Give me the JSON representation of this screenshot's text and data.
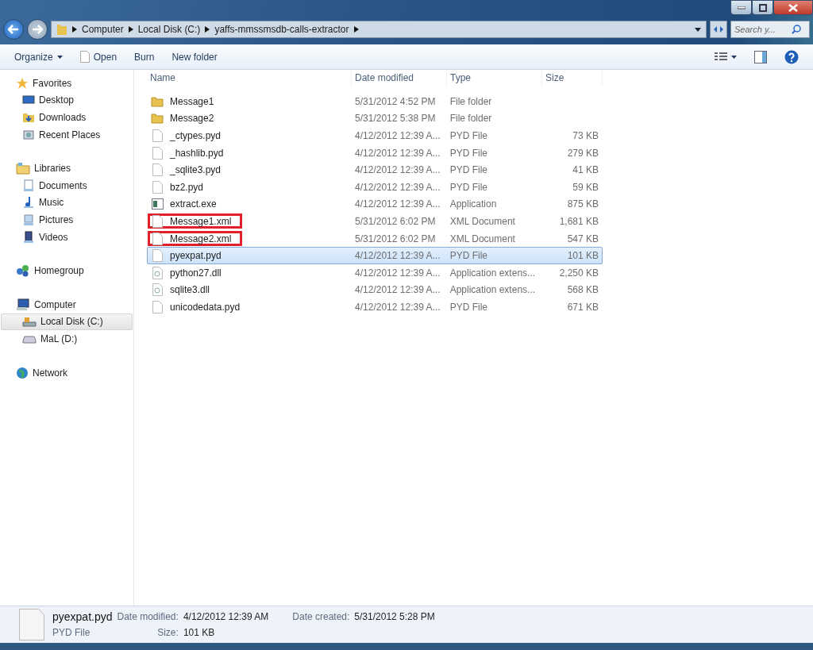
{
  "address": {
    "path": [
      "Computer",
      "Local Disk (C:)",
      "yaffs-mmssmsdb-calls-extractor"
    ],
    "search_placeholder": "Search y..."
  },
  "toolbar": [
    {
      "label": "Organize",
      "kind": "menu"
    },
    {
      "label": "Open",
      "kind": "icon"
    },
    {
      "label": "Burn",
      "kind": "plain"
    },
    {
      "label": "New folder",
      "kind": "plain"
    }
  ],
  "sidebar": [
    {
      "label": "Favorites",
      "kind": "star",
      "selected": false,
      "children": [
        {
          "label": "Desktop",
          "kind": "desktop",
          "selected": false
        },
        {
          "label": "Downloads",
          "kind": "download",
          "selected": false
        },
        {
          "label": "Recent Places",
          "kind": "recent",
          "selected": false
        }
      ]
    },
    {
      "label": "Libraries",
      "kind": "library",
      "selected": false,
      "children": [
        {
          "label": "Documents",
          "kind": "doc",
          "selected": false
        },
        {
          "label": "Music",
          "kind": "music",
          "selected": false
        },
        {
          "label": "Pictures",
          "kind": "picture",
          "selected": false
        },
        {
          "label": "Videos",
          "kind": "video",
          "selected": false
        }
      ]
    },
    {
      "label": "Homegroup",
      "kind": "homegroup",
      "selected": false
    },
    {
      "label": "Computer",
      "kind": "computer",
      "selected": false,
      "children": [
        {
          "label": "Local Disk (C:)",
          "kind": "disk",
          "selected": true
        },
        {
          "label": "MaL (D:)",
          "kind": "drive",
          "selected": false
        }
      ]
    },
    {
      "label": "Network",
      "kind": "network",
      "selected": false
    }
  ],
  "table": {
    "columns": [
      "Name",
      "Date modified",
      "Type",
      "Size"
    ],
    "rows": [
      {
        "kind": "folder",
        "name": "Message1",
        "date": "5/31/2012 4:52 PM",
        "type": "File folder",
        "size": "",
        "selected": false,
        "boxed": false
      },
      {
        "kind": "folder",
        "name": "Message2",
        "date": "5/31/2012 5:38 PM",
        "type": "File folder",
        "size": "",
        "selected": false,
        "boxed": false
      },
      {
        "kind": "file",
        "name": "_ctypes.pyd",
        "date": "4/12/2012 12:39 A...",
        "type": "PYD File",
        "size": "73 KB",
        "selected": false,
        "boxed": false
      },
      {
        "kind": "file",
        "name": "_hashlib.pyd",
        "date": "4/12/2012 12:39 A...",
        "type": "PYD File",
        "size": "279 KB",
        "selected": false,
        "boxed": false
      },
      {
        "kind": "file",
        "name": "_sqlite3.pyd",
        "date": "4/12/2012 12:39 A...",
        "type": "PYD File",
        "size": "41 KB",
        "selected": false,
        "boxed": false
      },
      {
        "kind": "file",
        "name": "bz2.pyd",
        "date": "4/12/2012 12:39 A...",
        "type": "PYD File",
        "size": "59 KB",
        "selected": false,
        "boxed": false
      },
      {
        "kind": "exe",
        "name": "extract.exe",
        "date": "4/12/2012 12:39 A...",
        "type": "Application",
        "size": "875 KB",
        "selected": false,
        "boxed": false
      },
      {
        "kind": "file",
        "name": "Message1.xml",
        "date": "5/31/2012 6:02 PM",
        "type": "XML Document",
        "size": "1,681 KB",
        "selected": false,
        "boxed": true
      },
      {
        "kind": "file",
        "name": "Message2.xml",
        "date": "5/31/2012 6:02 PM",
        "type": "XML Document",
        "size": "547 KB",
        "selected": false,
        "boxed": true
      },
      {
        "kind": "file",
        "name": "pyexpat.pyd",
        "date": "4/12/2012 12:39 A...",
        "type": "PYD File",
        "size": "101 KB",
        "selected": true,
        "boxed": false
      },
      {
        "kind": "dll",
        "name": "python27.dll",
        "date": "4/12/2012 12:39 A...",
        "type": "Application extens...",
        "size": "2,250 KB",
        "selected": false,
        "boxed": false
      },
      {
        "kind": "dll",
        "name": "sqlite3.dll",
        "date": "4/12/2012 12:39 A...",
        "type": "Application extens...",
        "size": "568 KB",
        "selected": false,
        "boxed": false
      },
      {
        "kind": "file",
        "name": "unicodedata.pyd",
        "date": "4/12/2012 12:39 A...",
        "type": "PYD File",
        "size": "671 KB",
        "selected": false,
        "boxed": false
      }
    ]
  },
  "details": {
    "name": "pyexpat.pyd",
    "type": "PYD File",
    "fields": [
      {
        "label": "Date modified:",
        "value": "4/12/2012 12:39 AM"
      },
      {
        "label": "Size:",
        "value": "101 KB"
      },
      {
        "label": "Date created:",
        "value": "5/31/2012 5:28 PM"
      }
    ]
  }
}
